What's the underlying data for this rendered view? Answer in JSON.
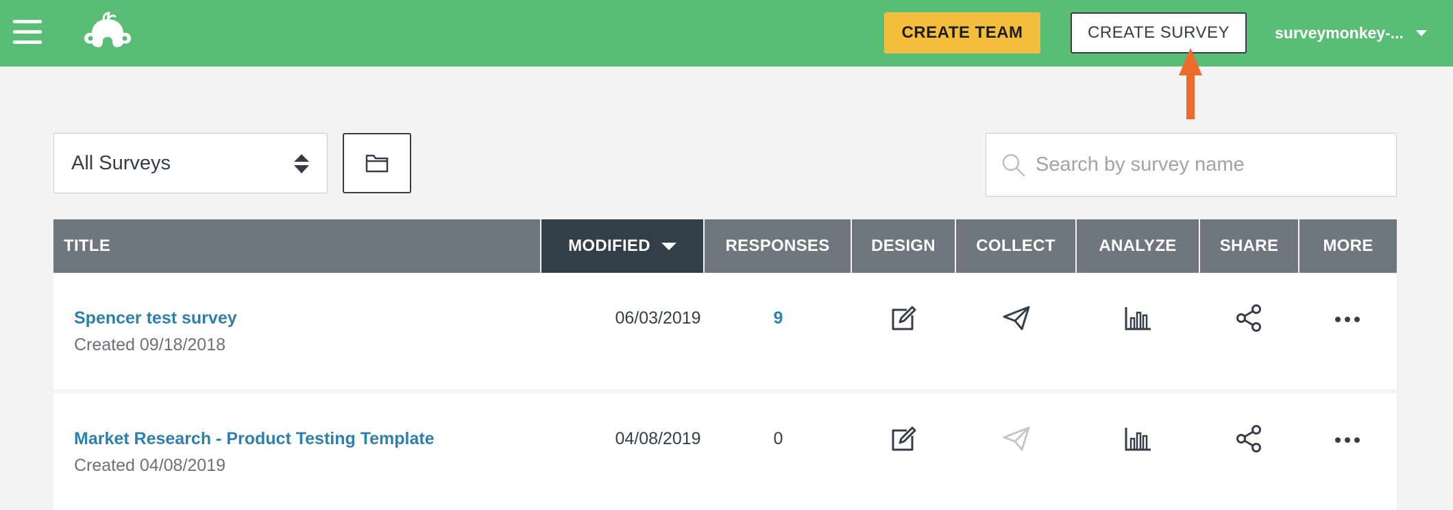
{
  "header": {
    "create_team_label": "CREATE TEAM",
    "create_survey_label": "CREATE SURVEY",
    "username": "surveymonkey-..."
  },
  "filter": {
    "selected": "All Surveys"
  },
  "search": {
    "placeholder": "Search by survey name"
  },
  "table": {
    "columns": [
      "TITLE",
      "MODIFIED",
      "RESPONSES",
      "DESIGN",
      "COLLECT",
      "ANALYZE",
      "SHARE",
      "MORE"
    ],
    "sorted_column": "MODIFIED",
    "rows": [
      {
        "title": "Spencer test survey",
        "created": "Created 09/18/2018",
        "modified": "06/03/2019",
        "responses": "9"
      },
      {
        "title": "Market Research - Product Testing Template",
        "created": "Created 04/08/2019",
        "modified": "04/08/2019",
        "responses": "0"
      }
    ]
  },
  "icons": {
    "menu": "hamburger-icon",
    "logo": "surveymonkey-logo",
    "folder": "folder-icon",
    "search": "search-icon",
    "design": "edit-icon",
    "collect": "send-icon",
    "analyze": "bar-chart-icon",
    "share": "share-icon",
    "more": "more-dots-icon"
  },
  "colors": {
    "header_bg": "#5abd76",
    "create_team_bg": "#f2be3c",
    "table_header_bg": "#6f767d",
    "table_header_active": "#333e48",
    "link": "#2f7fae",
    "annotation_arrow": "#ee6b2b"
  }
}
